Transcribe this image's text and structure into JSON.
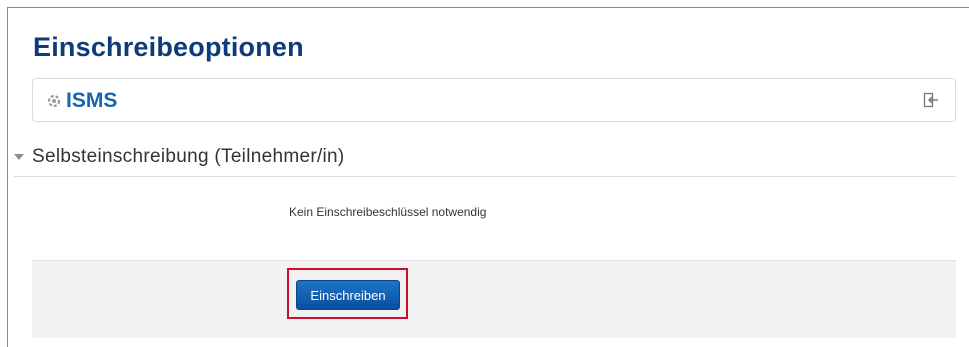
{
  "page": {
    "title": "Einschreibeoptionen"
  },
  "course": {
    "name": "ISMS",
    "icon": "course-gear-icon",
    "enrol_icon": "sign-in-icon"
  },
  "section": {
    "title": "Selbsteinschreibung (Teilnehmer/in)",
    "key_info": "Kein Einschreibeschlüssel notwendig",
    "button_label": "Einschreiben"
  },
  "colors": {
    "title": "#0d3c79",
    "course_link": "#1565b0",
    "button": "#0a4f9e",
    "highlight": "#c8102e",
    "panel_bg": "#f2f2f2"
  }
}
